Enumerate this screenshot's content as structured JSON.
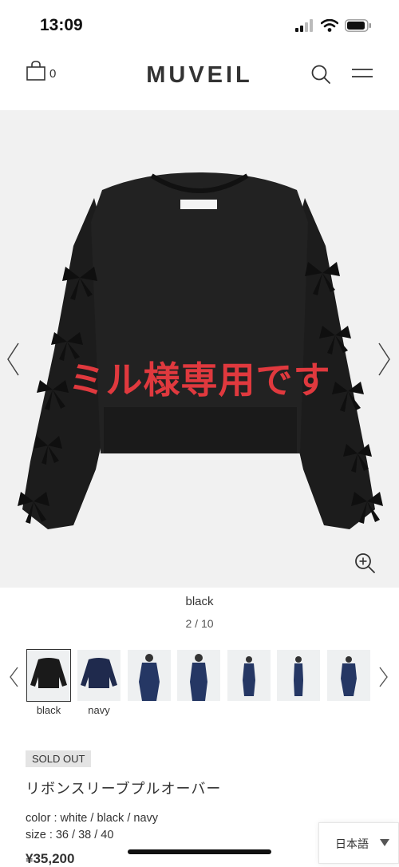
{
  "status": {
    "time": "13:09"
  },
  "header": {
    "logo": "MUVEIL",
    "cart_count": "0"
  },
  "hero": {
    "watermark": "ミル様専用です"
  },
  "product": {
    "selected_color": "black",
    "image_counter": "2 / 10",
    "thumbnails": [
      {
        "label": "black",
        "selected": true
      },
      {
        "label": "navy",
        "selected": false
      },
      {
        "label": "",
        "selected": false
      },
      {
        "label": "",
        "selected": false
      },
      {
        "label": "",
        "selected": false
      },
      {
        "label": "",
        "selected": false
      },
      {
        "label": "",
        "selected": false
      }
    ],
    "status_badge": "SOLD OUT",
    "title": "リボンスリーブプルオーバー",
    "color_line": "color : white / black / navy",
    "size_line": "size : 36 / 38 / 40",
    "price": "¥35,200"
  },
  "language": {
    "current": "日本語"
  },
  "icons": [
    "signal-icon",
    "wifi-icon",
    "battery-icon",
    "shopping-bag-icon",
    "search-icon",
    "menu-icon",
    "chevron-left-icon",
    "chevron-right-icon",
    "zoom-in-icon",
    "caret-down-icon"
  ]
}
